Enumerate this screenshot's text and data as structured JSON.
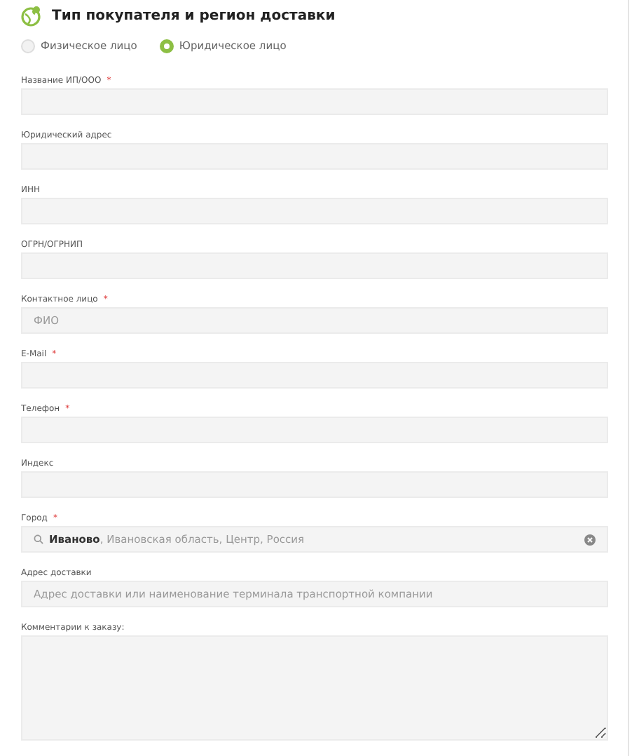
{
  "title": "Тип покупателя и регион доставки",
  "buyer_types": [
    {
      "label": "Физическое лицо",
      "selected": false
    },
    {
      "label": "Юридическое лицо",
      "selected": true
    }
  ],
  "fields": [
    {
      "label": "Название ИП/ООО",
      "required_mark": "*",
      "kind": "input"
    },
    {
      "label": "Юридический адрес",
      "kind": "input"
    },
    {
      "label": "ИНН",
      "kind": "input"
    },
    {
      "label": "ОГРН/ОГРНИП",
      "kind": "input"
    },
    {
      "label": "Контактное лицо",
      "required_mark": "*",
      "kind": "input",
      "placeholder": "ФИО"
    },
    {
      "label": "E-Mail",
      "required_mark": "*",
      "kind": "input"
    },
    {
      "label": "Телефон",
      "required_mark": "*",
      "kind": "input"
    },
    {
      "label": "Индекс",
      "kind": "input"
    },
    {
      "label": "Город",
      "required_mark": "*",
      "kind": "search",
      "value": "**Иваново**, Ивановская область, Центр, Россия"
    },
    {
      "label": "Адрес доставки",
      "kind": "input",
      "placeholder": "Адрес доставки или наименование терминала транспортной компании"
    },
    {
      "label": "Комментарии к заказу:",
      "kind": "textarea"
    }
  ]
}
